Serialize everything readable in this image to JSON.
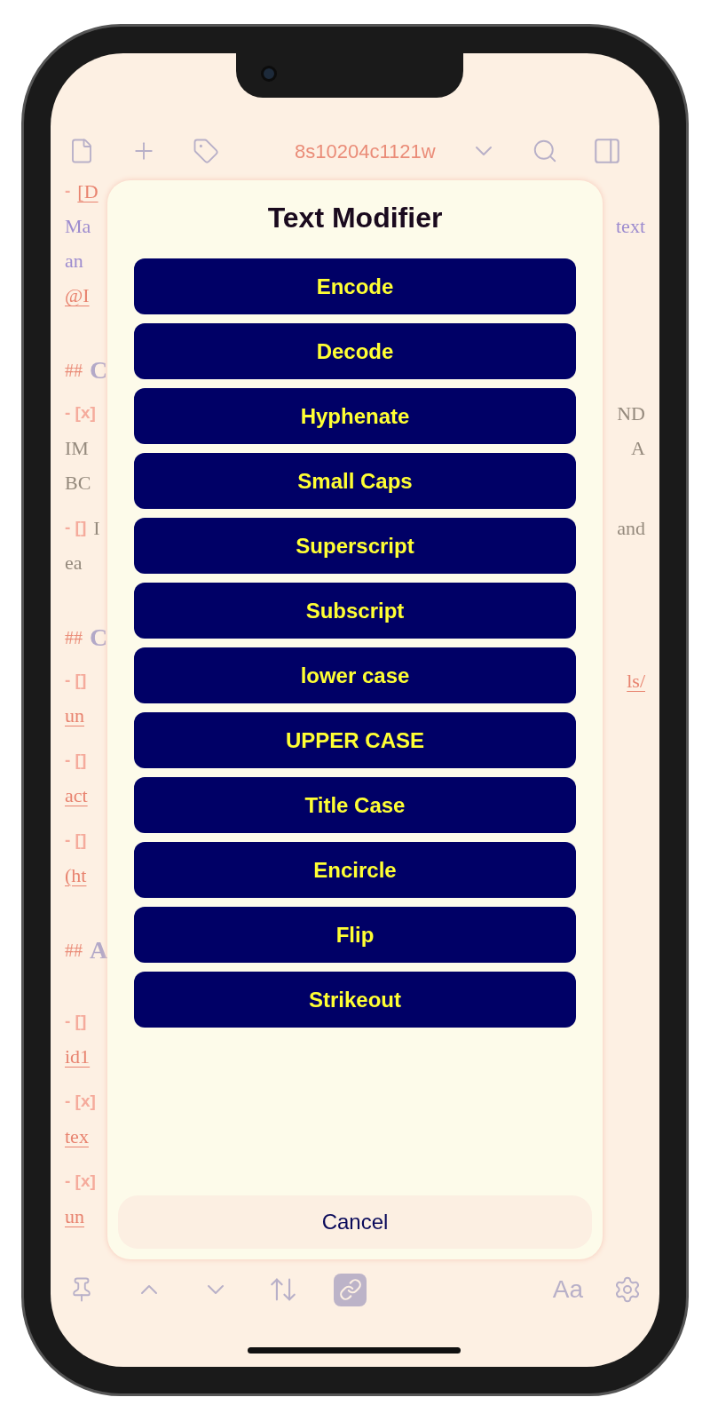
{
  "top_toolbar": {
    "note_id": "8s10204c1121w"
  },
  "sections": [
    {
      "lines": [
        {
          "marker": "-",
          "text": "[D",
          "kind": "link"
        },
        {
          "text": "Ma",
          "right": "text",
          "kind": "accent"
        },
        {
          "text": "an",
          "kind": "accent"
        },
        {
          "text": "@I",
          "kind": "link"
        }
      ]
    },
    {
      "heading_marker": "##",
      "heading": "C",
      "lines": [
        {
          "marker": "- [x]",
          "right": "ND",
          "kind": "plain"
        },
        {
          "text": "IM",
          "right": "A",
          "kind": "plain"
        },
        {
          "text": "BC",
          "kind": "plain"
        },
        {
          "marker": "- []",
          "text": "I",
          "right": "and",
          "kind": "plain"
        },
        {
          "text": "ea",
          "kind": "plain"
        }
      ]
    },
    {
      "heading_marker": "##",
      "heading": "C",
      "lines": [
        {
          "marker": "- []",
          "right": "ls/",
          "kind": "link"
        },
        {
          "text": "un",
          "kind": "link"
        },
        {
          "marker": "- []",
          "kind": "link"
        },
        {
          "text": "act",
          "kind": "link"
        },
        {
          "marker": "- []",
          "kind": "link"
        },
        {
          "text": "(ht",
          "kind": "link"
        }
      ]
    },
    {
      "heading_marker": "##",
      "heading": "A",
      "lines": [
        {
          "marker": "- []",
          "kind": "link"
        },
        {
          "text": "id1",
          "kind": "link"
        },
        {
          "marker": "- [x]",
          "kind": "link"
        },
        {
          "text": "tex",
          "kind": "link"
        },
        {
          "marker": "- [x]",
          "kind": "link"
        },
        {
          "text": "un",
          "kind": "link"
        }
      ]
    }
  ],
  "dialog": {
    "title": "Text Modifier",
    "options": [
      "Encode",
      "Decode",
      "Hyphenate",
      "Small Caps",
      "Superscript",
      "Subscript",
      "lower case",
      "UPPER CASE",
      "Title Case",
      "Encircle",
      "Flip",
      "Strikeout"
    ],
    "cancel": "Cancel"
  },
  "bottom_toolbar": {
    "font_button": "Aa",
    "link_active": true
  }
}
